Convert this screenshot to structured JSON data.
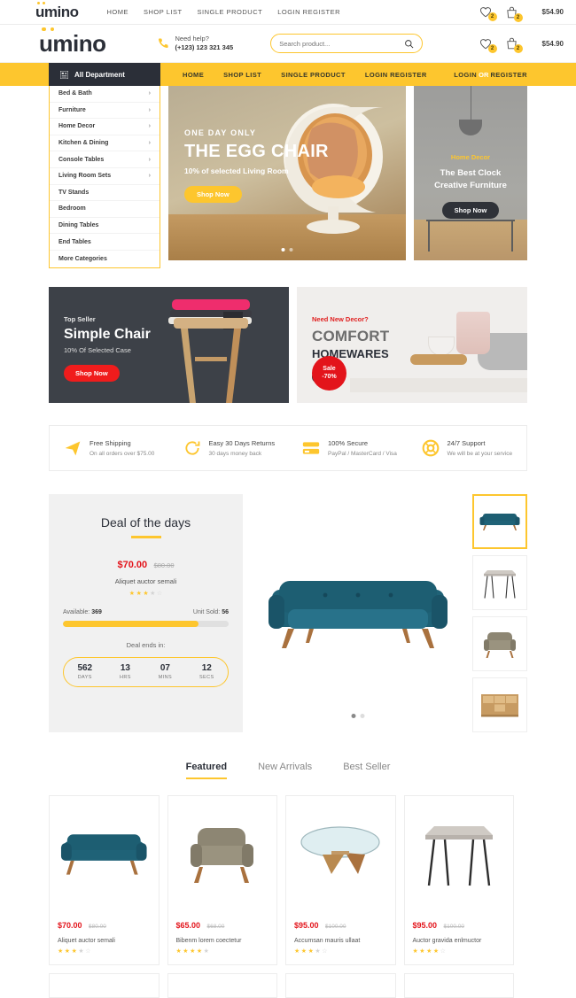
{
  "brand": {
    "name": "umino"
  },
  "topbar": {
    "nav": [
      {
        "label": "HOME"
      },
      {
        "label": "SHOP LIST"
      },
      {
        "label": "SINGLE PRODUCT"
      },
      {
        "label": "LOGIN REGISTER"
      }
    ],
    "wishlist_count": "2",
    "cart_count": "2",
    "cart_total": "$54.90"
  },
  "header": {
    "help_label": "Need help?",
    "phone": "(+123) 123 321 345",
    "search_placeholder": "Search product...",
    "wishlist_count": "2",
    "cart_count": "2",
    "cart_total": "$54.90"
  },
  "navbar": {
    "department_label": "All Department",
    "links": [
      {
        "label": "HOME"
      },
      {
        "label": "SHOP LIST"
      },
      {
        "label": "SINGLE PRODUCT"
      },
      {
        "label": "LOGIN REGISTER"
      }
    ],
    "login": "LOGIN",
    "or": "OR",
    "register": "REGISTER"
  },
  "sidebar": {
    "items": [
      {
        "label": "Bed & Bath",
        "arrow": true
      },
      {
        "label": "Furniture",
        "arrow": true
      },
      {
        "label": "Home Decor",
        "arrow": true
      },
      {
        "label": "Kitchen & Dining",
        "arrow": true
      },
      {
        "label": "Console Tables",
        "arrow": true
      },
      {
        "label": "Living Room Sets",
        "arrow": true
      },
      {
        "label": "TV Stands",
        "arrow": false
      },
      {
        "label": "Bedroom",
        "arrow": false
      },
      {
        "label": "Dining Tables",
        "arrow": false
      },
      {
        "label": "End Tables",
        "arrow": false
      },
      {
        "label": "More Categories",
        "arrow": false
      }
    ]
  },
  "hero": {
    "kicker": "ONE DAY ONLY",
    "title": "THE EGG CHAIR",
    "subtitle": "10% of selected Living Room",
    "cta": "Shop Now"
  },
  "hero_side": {
    "kicker": "Home Decor",
    "title_line1": "The Best Clock",
    "title_line2": "Creative Furniture",
    "cta": "Shop Now"
  },
  "promo_left": {
    "kicker": "Top Seller",
    "title": "Simple Chair",
    "subtitle": "10% Of Selected Case",
    "cta": "Shop Now"
  },
  "promo_right": {
    "kicker": "Need New Decor?",
    "title": "COMFORT",
    "title2": "HOMEWARES",
    "sale_line1": "Sale",
    "sale_line2": "-70%"
  },
  "services": [
    {
      "icon": "paper-plane-icon",
      "title": "Free Shipping",
      "desc": "On all orders over $75.00"
    },
    {
      "icon": "refresh-icon",
      "title": "Easy 30 Days Returns",
      "desc": "30 days money back"
    },
    {
      "icon": "credit-card-icon",
      "title": "100% Secure",
      "desc": "PayPal / MasterCard / Visa"
    },
    {
      "icon": "lifebuoy-icon",
      "title": "24/7 Support",
      "desc": "We will be at your service"
    }
  ],
  "deal": {
    "title": "Deal of the days",
    "price": "$70.00",
    "old_price": "$80.00",
    "name": "Aliquet auctor semali",
    "rating": 3,
    "available_label": "Available:",
    "available_value": "369",
    "sold_label": "Unit Sold:",
    "sold_value": "56",
    "progress_percent": 82,
    "ends_label": "Deal ends in:",
    "timer": [
      {
        "value": "562",
        "unit": "DAYS"
      },
      {
        "value": "13",
        "unit": "HRS"
      },
      {
        "value": "07",
        "unit": "MINS"
      },
      {
        "value": "12",
        "unit": "SECS"
      }
    ],
    "thumbnails": [
      {
        "name": "teal-sofa-thumbnail",
        "selected": true
      },
      {
        "name": "hairpin-table-thumbnail",
        "selected": false
      },
      {
        "name": "beige-armchair-thumbnail",
        "selected": false
      },
      {
        "name": "wooden-cabinet-thumbnail",
        "selected": false
      }
    ]
  },
  "tabs": [
    {
      "label": "Featured",
      "active": true
    },
    {
      "label": "New Arrivals",
      "active": false
    },
    {
      "label": "Best Seller",
      "active": false
    }
  ],
  "products": [
    {
      "image": "teal-sofa",
      "price": "$70.00",
      "old_price": "$80.00",
      "name": "Aliquet auctor semali",
      "rating": 3.5
    },
    {
      "image": "beige-armchair",
      "price": "$65.00",
      "old_price": "$68.00",
      "name": "Bibenm lorem coectetur",
      "rating": 4.5
    },
    {
      "image": "glass-coffee-table",
      "price": "$95.00",
      "old_price": "$100.00",
      "name": "Accumsan mauris ullaat",
      "rating": 3.5
    },
    {
      "image": "hairpin-side-table",
      "price": "$95.00",
      "old_price": "$100.00",
      "name": "Auctor gravida enlmuctor",
      "rating": 4
    }
  ],
  "colors": {
    "accent": "#fdc62e",
    "dark": "#2b2f38",
    "sale_red": "#e3141b",
    "teal": "#19586b"
  }
}
